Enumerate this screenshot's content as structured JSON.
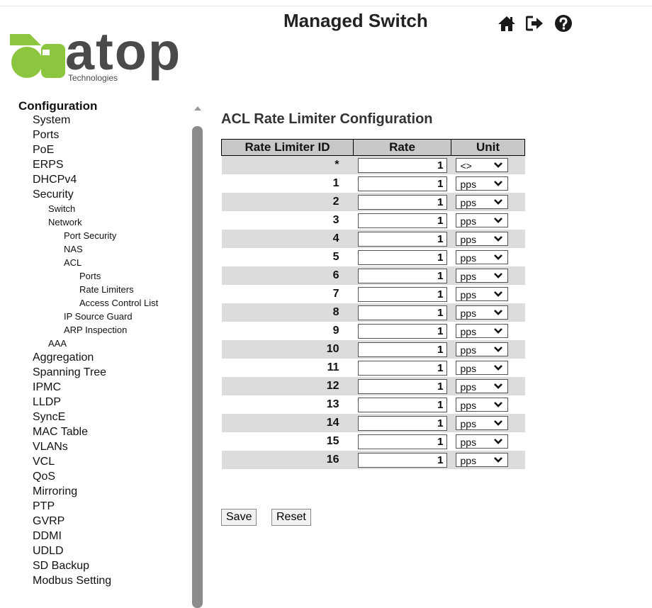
{
  "header": {
    "app_title": "Managed Switch",
    "logo_text": "atop",
    "logo_subtext": "Technologies",
    "icons": [
      "home-icon",
      "logout-icon",
      "help-icon"
    ]
  },
  "sidebar": {
    "items": [
      {
        "label": "Configuration",
        "level": 0
      },
      {
        "label": "System",
        "level": 1
      },
      {
        "label": "Ports",
        "level": 1
      },
      {
        "label": "PoE",
        "level": 1
      },
      {
        "label": "ERPS",
        "level": 1
      },
      {
        "label": "DHCPv4",
        "level": 1
      },
      {
        "label": "Security",
        "level": 1
      },
      {
        "label": "Switch",
        "level": 2
      },
      {
        "label": "Network",
        "level": 2
      },
      {
        "label": "Port Security",
        "level": 3
      },
      {
        "label": "NAS",
        "level": 3
      },
      {
        "label": "ACL",
        "level": 3
      },
      {
        "label": "Ports",
        "level": 4
      },
      {
        "label": "Rate Limiters",
        "level": 4
      },
      {
        "label": "Access Control List",
        "level": 4
      },
      {
        "label": "IP Source Guard",
        "level": 3
      },
      {
        "label": "ARP Inspection",
        "level": 3
      },
      {
        "label": "AAA",
        "level": 2
      },
      {
        "label": "Aggregation",
        "level": 1
      },
      {
        "label": "Spanning Tree",
        "level": 1
      },
      {
        "label": "IPMC",
        "level": 1
      },
      {
        "label": "LLDP",
        "level": 1
      },
      {
        "label": "SyncE",
        "level": 1
      },
      {
        "label": "MAC Table",
        "level": 1
      },
      {
        "label": "VLANs",
        "level": 1
      },
      {
        "label": "VCL",
        "level": 1
      },
      {
        "label": "QoS",
        "level": 1
      },
      {
        "label": "Mirroring",
        "level": 1
      },
      {
        "label": "PTP",
        "level": 1
      },
      {
        "label": "GVRP",
        "level": 1
      },
      {
        "label": "DDMI",
        "level": 1
      },
      {
        "label": "UDLD",
        "level": 1
      },
      {
        "label": "SD Backup",
        "level": 1
      },
      {
        "label": "Modbus Setting",
        "level": 1
      }
    ]
  },
  "main": {
    "title": "ACL Rate Limiter Configuration",
    "table": {
      "headers": [
        "Rate Limiter ID",
        "Rate",
        "Unit"
      ],
      "rows": [
        {
          "id": "*",
          "rate": "1",
          "unit": "<>"
        },
        {
          "id": "1",
          "rate": "1",
          "unit": "pps"
        },
        {
          "id": "2",
          "rate": "1",
          "unit": "pps"
        },
        {
          "id": "3",
          "rate": "1",
          "unit": "pps"
        },
        {
          "id": "4",
          "rate": "1",
          "unit": "pps"
        },
        {
          "id": "5",
          "rate": "1",
          "unit": "pps"
        },
        {
          "id": "6",
          "rate": "1",
          "unit": "pps"
        },
        {
          "id": "7",
          "rate": "1",
          "unit": "pps"
        },
        {
          "id": "8",
          "rate": "1",
          "unit": "pps"
        },
        {
          "id": "9",
          "rate": "1",
          "unit": "pps"
        },
        {
          "id": "10",
          "rate": "1",
          "unit": "pps"
        },
        {
          "id": "11",
          "rate": "1",
          "unit": "pps"
        },
        {
          "id": "12",
          "rate": "1",
          "unit": "pps"
        },
        {
          "id": "13",
          "rate": "1",
          "unit": "pps"
        },
        {
          "id": "14",
          "rate": "1",
          "unit": "pps"
        },
        {
          "id": "15",
          "rate": "1",
          "unit": "pps"
        },
        {
          "id": "16",
          "rate": "1",
          "unit": "pps"
        }
      ]
    },
    "buttons": {
      "save": "Save",
      "reset": "Reset"
    }
  },
  "colors": {
    "logo_green": "#8cc63f",
    "header_bg": "#c8c8c8",
    "row_shade": "#dcdcdc",
    "scroll_thumb": "#8c8c8c"
  }
}
